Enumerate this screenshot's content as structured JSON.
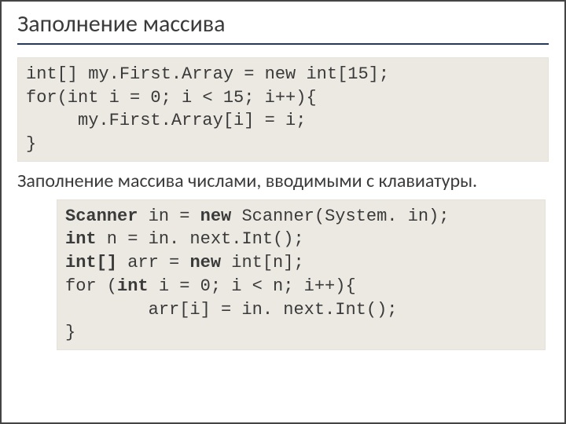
{
  "title": "Заполнение массива",
  "code1": {
    "l1": "int[] my.First.Array = new int[15];",
    "l2": "for(int i = 0; i < 15; i++){",
    "l3": "     my.First.Array[i] = i;",
    "l4": "}"
  },
  "bodytext": "Заполнение массива числами, вводимыми с клавиатуры.",
  "code2": {
    "kw_scanner": "Scanner",
    "l1_rest": " in = ",
    "kw_new": "new",
    "l1_rest2": " Scanner(System. in);",
    "kw_int": "int",
    "l2_rest": " n = in. next.Int();",
    "kw_intarr": "int[]",
    "l3_rest": " arr = ",
    "kw_new2": "new",
    "l3_rest2": " int[n];",
    "l4_pre": "for (",
    "kw_int2": "int",
    "l4_rest": " i = 0; i < n; i++){",
    "l5": "        arr[i] = in. next.Int();",
    "l6": "}"
  }
}
